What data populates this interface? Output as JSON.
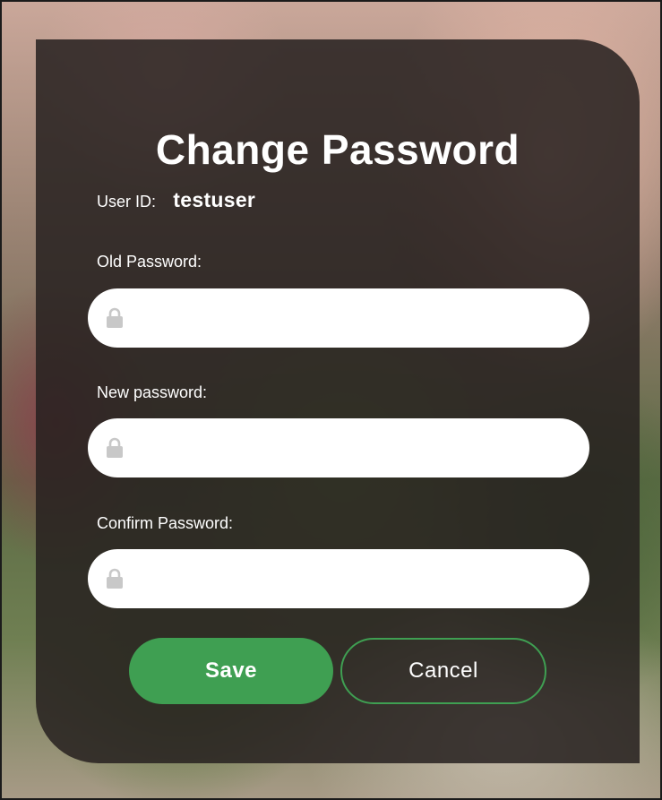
{
  "dialog": {
    "title": "Change Password"
  },
  "user": {
    "label": "User ID:",
    "value": "testuser"
  },
  "fields": {
    "old_password": {
      "label": "Old Password:",
      "value": "",
      "icon": "lock-icon"
    },
    "new_password": {
      "label": "New password:",
      "value": "",
      "icon": "lock-icon"
    },
    "confirm_password": {
      "label": "Confirm Password:",
      "value": "",
      "icon": "lock-icon"
    }
  },
  "actions": {
    "save_label": "Save",
    "cancel_label": "Cancel"
  },
  "colors": {
    "accent": "#3f9f52",
    "card_background": "#26211f",
    "text": "#ffffff",
    "lock_icon": "#c8c8c8"
  }
}
